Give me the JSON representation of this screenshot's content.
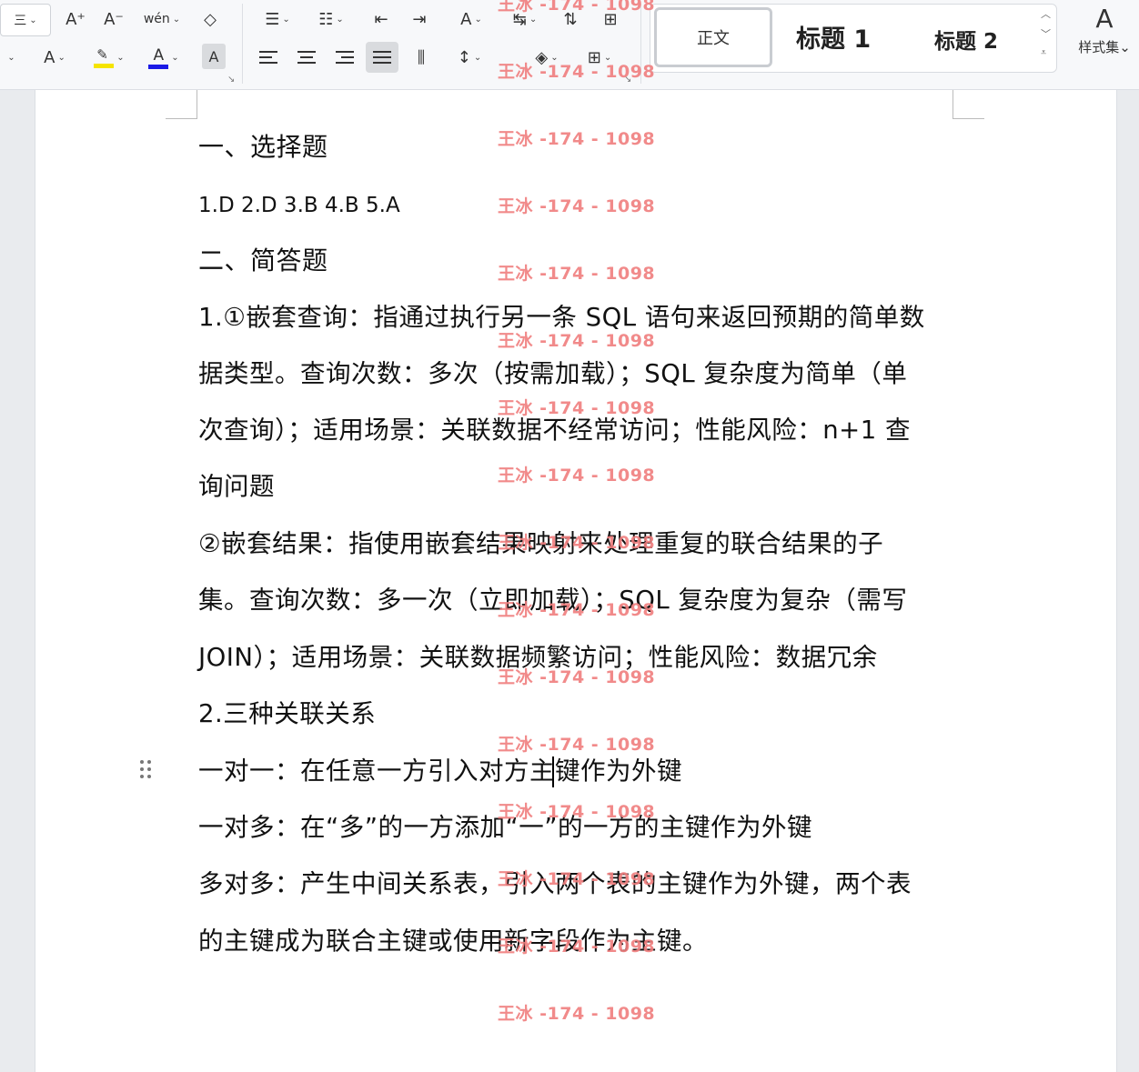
{
  "ribbon": {
    "font_size_increase": "A⁺",
    "font_size_decrease": "A⁻",
    "phonetic_guide": "wén",
    "style_normal": "正文",
    "style_heading1": "标题 1",
    "style_heading2": "标题 2",
    "style_set_label": "样式集",
    "highlight_color": "#f5e400",
    "font_color": "#1a1ae6"
  },
  "document": {
    "section1_title": "一、选择题",
    "answers": "1.D 2.D 3.B 4.B 5.A",
    "section2_title": "二、简答题",
    "q1_line1": "1.①嵌套查询：指通过执行另一条 SQL 语句来返回预期的简单数",
    "q1_line2": "据类型。查询次数：多次（按需加载）；SQL 复杂度为简单（单",
    "q1_line3": "次查询）；适用场景：关联数据不经常访问；性能风险：n+1 查",
    "q1_line4": "询问题",
    "q1b_line1": "  ②嵌套结果：指使用嵌套结果映射来处理重复的联合结果的子",
    "q1b_line2": "集。查询次数：多一次（立即加载）；SQL 复杂度为复杂（需写",
    "q1b_line3": "JOIN）；适用场景：关联数据频繁访问；性能风险：数据冗余",
    "q2_title": "2.三种关联关系",
    "one_to_one": "一对一：在任意一方引入对方主键作为外键",
    "one_to_many": "一对多：在“多”的一方添加“一”的一方的主键作为外键",
    "many_to_many_1": "多对多：产生中间关系表，引入两个表的主键作为外键，两个表",
    "many_to_many_2": "的主键成为联合主键或使用新字段作为主键。"
  },
  "watermark": "王冰 -174 - 1098"
}
